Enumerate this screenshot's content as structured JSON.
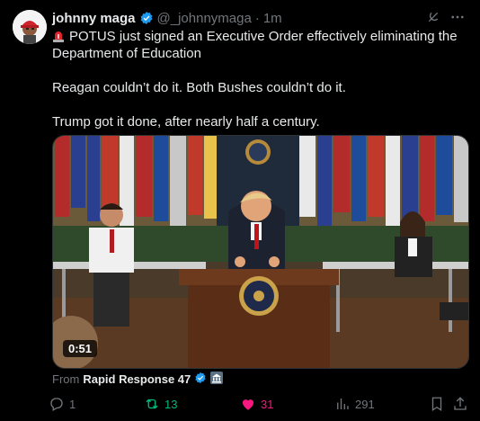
{
  "post": {
    "author_name": "johnny maga",
    "author_handle": "@_johnnymaga",
    "separator": "·",
    "time": "1m",
    "lines": [
      "POTUS just signed an Executive Order effectively eliminating the Department of Education",
      "Reagan couldn’t do it. Both Bushes couldn’t do it.",
      "Trump got it done, after nearly half a century."
    ]
  },
  "media": {
    "duration": "0:51"
  },
  "source": {
    "prefix": "From",
    "name": "Rapid Response 47"
  },
  "actions": {
    "replies": "1",
    "reposts": "13",
    "likes": "31",
    "views": "291"
  },
  "colors": {
    "background": "#000000",
    "text": "#e7e9ea",
    "muted": "#71767b",
    "verified": "#1d9bf0",
    "repost": "#00ba7c",
    "like": "#f91880"
  },
  "icons": [
    "grok-icon",
    "more-icon",
    "verified-badge-icon",
    "siren-emoji",
    "government-badge-icon",
    "reply-icon",
    "repost-icon",
    "like-icon",
    "views-icon",
    "bookmark-icon",
    "share-icon"
  ]
}
